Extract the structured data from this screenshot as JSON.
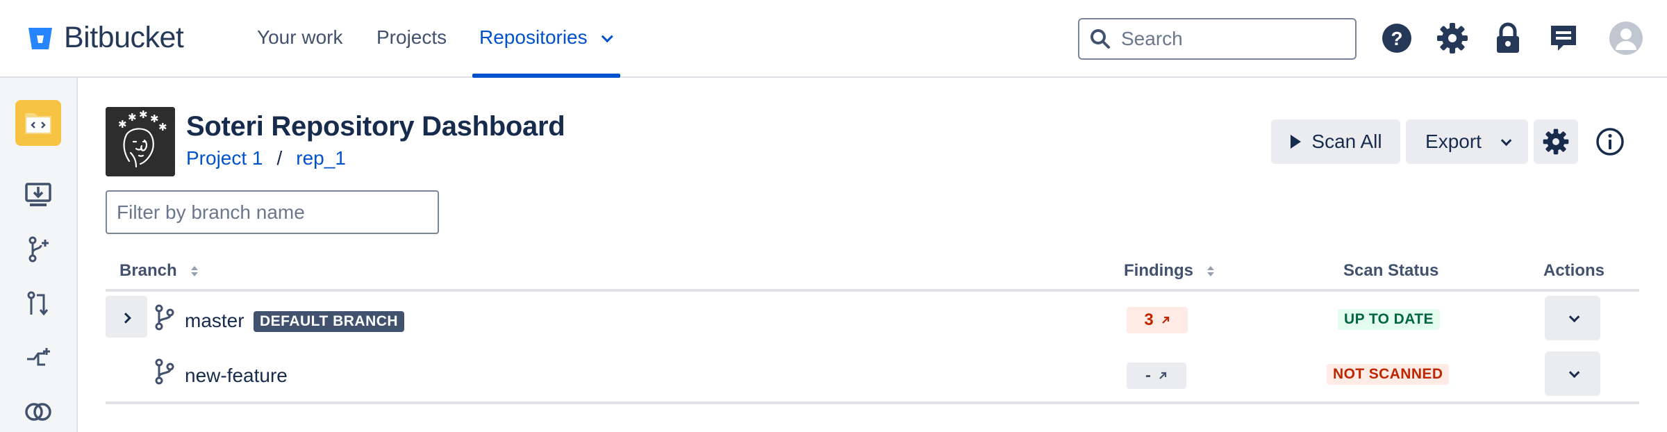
{
  "header": {
    "brand": "Bitbucket",
    "nav": [
      {
        "label": "Your work"
      },
      {
        "label": "Projects"
      },
      {
        "label": "Repositories",
        "active": true
      }
    ],
    "search": {
      "placeholder": "Search"
    },
    "icons": [
      "help-icon",
      "gear-icon",
      "lock-icon",
      "notes-icon",
      "avatar"
    ]
  },
  "sidebar": {
    "icons": [
      "repo-avatar",
      "clone-icon",
      "create-branch-icon",
      "pull-request-icon",
      "compare-icon",
      "overlap-icon"
    ]
  },
  "main": {
    "title": "Soteri Repository Dashboard",
    "breadcrumb": {
      "project": "Project 1",
      "separator": "/",
      "repo": "rep_1"
    },
    "buttons": {
      "scan_all": "Scan All",
      "export": "Export"
    },
    "filter": {
      "placeholder": "Filter by branch name"
    }
  },
  "table": {
    "headers": {
      "branch": "Branch",
      "findings": "Findings",
      "scan_status": "Scan Status",
      "actions": "Actions"
    },
    "rows": [
      {
        "branch": "master",
        "badge": "DEFAULT BRANCH",
        "findings": "3",
        "status": "UP TO DATE",
        "status_color": "#006644"
      },
      {
        "branch": "new-feature",
        "badge": "",
        "findings": "-",
        "status": "NOT SCANNED",
        "status_color": "#BF2600"
      }
    ]
  },
  "colors": {
    "accent": "#0052CC",
    "text": "#172B4D"
  }
}
